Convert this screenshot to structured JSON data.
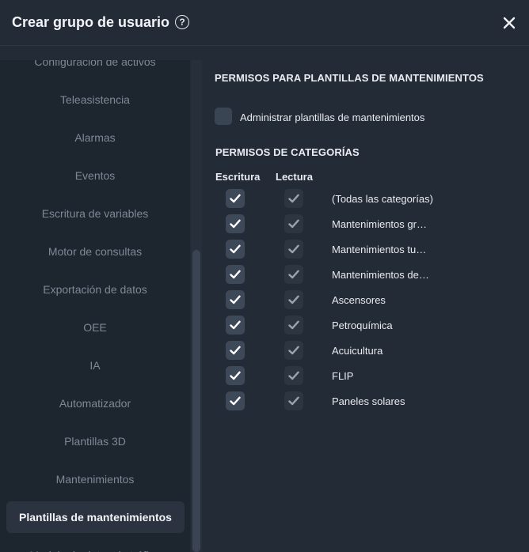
{
  "header": {
    "title": "Crear grupo de usuario",
    "help_glyph": "?"
  },
  "sidebar": {
    "items": [
      {
        "label": "Configuración de activos"
      },
      {
        "label": "Teleasistencia"
      },
      {
        "label": "Alarmas"
      },
      {
        "label": "Eventos"
      },
      {
        "label": "Escritura de variables"
      },
      {
        "label": "Motor de consultas"
      },
      {
        "label": "Exportación de datos"
      },
      {
        "label": "OEE"
      },
      {
        "label": "IA"
      },
      {
        "label": "Automatizador"
      },
      {
        "label": "Plantillas 3D"
      },
      {
        "label": "Mantenimientos"
      },
      {
        "label": "Plantillas de mantenimientos",
        "active": true
      },
      {
        "label": "Modelo de datos de tráfico"
      }
    ]
  },
  "main": {
    "section_title": "PERMISOS PARA PLANTILLAS DE MANTENIMIENTOS",
    "admin_checkbox": {
      "label": "Administrar plantillas de mantenimientos",
      "checked": false
    },
    "categories_title": "PERMISOS DE CATEGORÍAS",
    "columns": {
      "write": "Escritura",
      "read": "Lectura"
    },
    "categories": [
      {
        "label": "(Todas las categorías)",
        "write": true,
        "read": true
      },
      {
        "label": "Mantenimientos gr…",
        "write": true,
        "read": true
      },
      {
        "label": "Mantenimientos tu…",
        "write": true,
        "read": true
      },
      {
        "label": "Mantenimientos de…",
        "write": true,
        "read": true
      },
      {
        "label": "Ascensores",
        "write": true,
        "read": true
      },
      {
        "label": "Petroquímica",
        "write": true,
        "read": true
      },
      {
        "label": "Acuicultura",
        "write": true,
        "read": true
      },
      {
        "label": "FLIP",
        "write": true,
        "read": true
      },
      {
        "label": "Paneles solares",
        "write": true,
        "read": true
      }
    ]
  },
  "colors": {
    "background": "#232b36",
    "sidebar_bg": "#1d252f",
    "sidebar_active": "#2a333f",
    "checkbox_write": "#3d4858",
    "checkbox_read": "#2d3541",
    "check_write": "#ffffff",
    "check_read": "#9aa3ae"
  },
  "icons": {
    "help": "question-circle-icon",
    "close": "close-icon",
    "check": "checkmark-icon"
  }
}
